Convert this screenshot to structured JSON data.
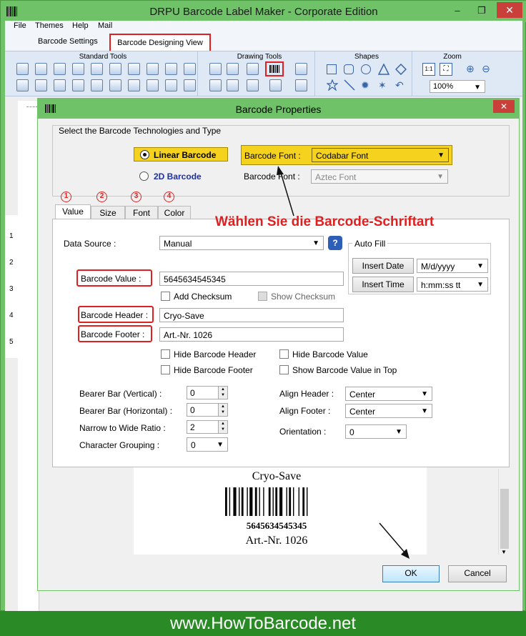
{
  "app": {
    "title": "DRPU Barcode Label Maker - Corporate Edition"
  },
  "menu": [
    "File",
    "Themes",
    "Help",
    "Mail"
  ],
  "ribbon_tabs": {
    "settings": "Barcode Settings",
    "design": "Barcode Designing View"
  },
  "ribbon_groups": {
    "standard": "Standard Tools",
    "drawing": "Drawing Tools",
    "shapes": "Shapes",
    "zoom": "Zoom"
  },
  "zoom": {
    "value": "100%"
  },
  "ruler": [
    "1",
    "2",
    "3",
    "4",
    "5"
  ],
  "dialog": {
    "title": "Barcode Properties",
    "tech_group": "Select the Barcode Technologies and Type",
    "linear_label": "Linear Barcode",
    "twod_label": "2D Barcode",
    "font_label": "Barcode Font :",
    "font_value": "Codabar Font",
    "font2_label": "Barcode Font :",
    "font2_value": "Aztec Font",
    "annotation": "Wählen Sie die Barcode-Schriftart",
    "tabs": [
      "Value",
      "Size",
      "Font",
      "Color"
    ],
    "tab_numbers": [
      "1",
      "2",
      "3",
      "4"
    ],
    "data_source_label": "Data Source :",
    "data_source": "Manual",
    "help_icon": "?",
    "barcode_value_label": "Barcode Value :",
    "barcode_value": "5645634545345",
    "add_checksum": "Add Checksum",
    "show_checksum": "Show Checksum",
    "header_label": "Barcode Header :",
    "header_value": "Cryo-Save",
    "footer_label": "Barcode Footer :",
    "footer_value": "Art.-Nr. 1026",
    "autofill": "Auto Fill",
    "insert_date": "Insert Date",
    "date_format": "M/d/yyyy",
    "insert_time": "Insert Time",
    "time_format": "h:mm:ss tt",
    "hide_header": "Hide Barcode Header",
    "hide_footer": "Hide Barcode Footer",
    "hide_value": "Hide Barcode Value",
    "show_value_top": "Show Barcode Value in Top",
    "bearer_v_label": "Bearer Bar (Vertical) :",
    "bearer_v": "0",
    "bearer_h_label": "Bearer Bar (Horizontal) :",
    "bearer_h": "0",
    "ratio_label": "Narrow to Wide Ratio :",
    "ratio": "2",
    "grouping_label": "Character Grouping :",
    "grouping": "0",
    "align_header_label": "Align Header :",
    "align_header": "Center",
    "align_footer_label": "Align Footer :",
    "align_footer": "Center",
    "orientation_label": "Orientation :",
    "orientation": "0",
    "preview": {
      "header": "Cryo-Save",
      "value": "5645634545345",
      "footer": "Art.-Nr. 1026"
    },
    "ok": "OK",
    "cancel": "Cancel"
  },
  "footer": "www.HowToBarcode.net"
}
